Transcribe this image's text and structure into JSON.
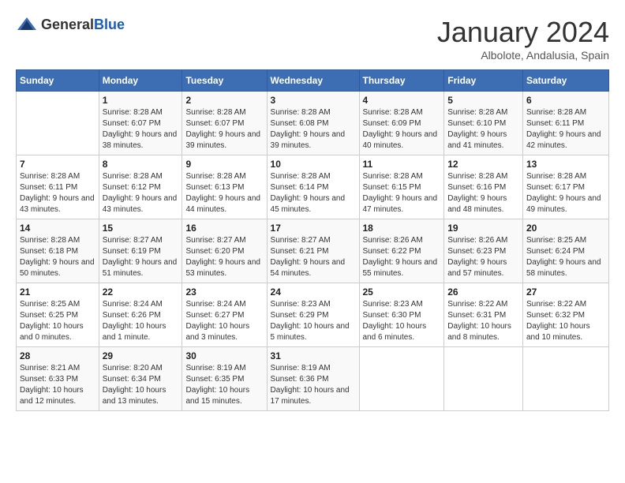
{
  "header": {
    "logo_general": "General",
    "logo_blue": "Blue",
    "title": "January 2024",
    "subtitle": "Albolote, Andalusia, Spain"
  },
  "calendar": {
    "days_of_week": [
      "Sunday",
      "Monday",
      "Tuesday",
      "Wednesday",
      "Thursday",
      "Friday",
      "Saturday"
    ],
    "weeks": [
      [
        {
          "day": "",
          "sunrise": "",
          "sunset": "",
          "daylight": ""
        },
        {
          "day": "1",
          "sunrise": "Sunrise: 8:28 AM",
          "sunset": "Sunset: 6:07 PM",
          "daylight": "Daylight: 9 hours and 38 minutes."
        },
        {
          "day": "2",
          "sunrise": "Sunrise: 8:28 AM",
          "sunset": "Sunset: 6:07 PM",
          "daylight": "Daylight: 9 hours and 39 minutes."
        },
        {
          "day": "3",
          "sunrise": "Sunrise: 8:28 AM",
          "sunset": "Sunset: 6:08 PM",
          "daylight": "Daylight: 9 hours and 39 minutes."
        },
        {
          "day": "4",
          "sunrise": "Sunrise: 8:28 AM",
          "sunset": "Sunset: 6:09 PM",
          "daylight": "Daylight: 9 hours and 40 minutes."
        },
        {
          "day": "5",
          "sunrise": "Sunrise: 8:28 AM",
          "sunset": "Sunset: 6:10 PM",
          "daylight": "Daylight: 9 hours and 41 minutes."
        },
        {
          "day": "6",
          "sunrise": "Sunrise: 8:28 AM",
          "sunset": "Sunset: 6:11 PM",
          "daylight": "Daylight: 9 hours and 42 minutes."
        }
      ],
      [
        {
          "day": "7",
          "sunrise": "Sunrise: 8:28 AM",
          "sunset": "Sunset: 6:11 PM",
          "daylight": "Daylight: 9 hours and 43 minutes."
        },
        {
          "day": "8",
          "sunrise": "Sunrise: 8:28 AM",
          "sunset": "Sunset: 6:12 PM",
          "daylight": "Daylight: 9 hours and 43 minutes."
        },
        {
          "day": "9",
          "sunrise": "Sunrise: 8:28 AM",
          "sunset": "Sunset: 6:13 PM",
          "daylight": "Daylight: 9 hours and 44 minutes."
        },
        {
          "day": "10",
          "sunrise": "Sunrise: 8:28 AM",
          "sunset": "Sunset: 6:14 PM",
          "daylight": "Daylight: 9 hours and 45 minutes."
        },
        {
          "day": "11",
          "sunrise": "Sunrise: 8:28 AM",
          "sunset": "Sunset: 6:15 PM",
          "daylight": "Daylight: 9 hours and 47 minutes."
        },
        {
          "day": "12",
          "sunrise": "Sunrise: 8:28 AM",
          "sunset": "Sunset: 6:16 PM",
          "daylight": "Daylight: 9 hours and 48 minutes."
        },
        {
          "day": "13",
          "sunrise": "Sunrise: 8:28 AM",
          "sunset": "Sunset: 6:17 PM",
          "daylight": "Daylight: 9 hours and 49 minutes."
        }
      ],
      [
        {
          "day": "14",
          "sunrise": "Sunrise: 8:28 AM",
          "sunset": "Sunset: 6:18 PM",
          "daylight": "Daylight: 9 hours and 50 minutes."
        },
        {
          "day": "15",
          "sunrise": "Sunrise: 8:27 AM",
          "sunset": "Sunset: 6:19 PM",
          "daylight": "Daylight: 9 hours and 51 minutes."
        },
        {
          "day": "16",
          "sunrise": "Sunrise: 8:27 AM",
          "sunset": "Sunset: 6:20 PM",
          "daylight": "Daylight: 9 hours and 53 minutes."
        },
        {
          "day": "17",
          "sunrise": "Sunrise: 8:27 AM",
          "sunset": "Sunset: 6:21 PM",
          "daylight": "Daylight: 9 hours and 54 minutes."
        },
        {
          "day": "18",
          "sunrise": "Sunrise: 8:26 AM",
          "sunset": "Sunset: 6:22 PM",
          "daylight": "Daylight: 9 hours and 55 minutes."
        },
        {
          "day": "19",
          "sunrise": "Sunrise: 8:26 AM",
          "sunset": "Sunset: 6:23 PM",
          "daylight": "Daylight: 9 hours and 57 minutes."
        },
        {
          "day": "20",
          "sunrise": "Sunrise: 8:25 AM",
          "sunset": "Sunset: 6:24 PM",
          "daylight": "Daylight: 9 hours and 58 minutes."
        }
      ],
      [
        {
          "day": "21",
          "sunrise": "Sunrise: 8:25 AM",
          "sunset": "Sunset: 6:25 PM",
          "daylight": "Daylight: 10 hours and 0 minutes."
        },
        {
          "day": "22",
          "sunrise": "Sunrise: 8:24 AM",
          "sunset": "Sunset: 6:26 PM",
          "daylight": "Daylight: 10 hours and 1 minute."
        },
        {
          "day": "23",
          "sunrise": "Sunrise: 8:24 AM",
          "sunset": "Sunset: 6:27 PM",
          "daylight": "Daylight: 10 hours and 3 minutes."
        },
        {
          "day": "24",
          "sunrise": "Sunrise: 8:23 AM",
          "sunset": "Sunset: 6:29 PM",
          "daylight": "Daylight: 10 hours and 5 minutes."
        },
        {
          "day": "25",
          "sunrise": "Sunrise: 8:23 AM",
          "sunset": "Sunset: 6:30 PM",
          "daylight": "Daylight: 10 hours and 6 minutes."
        },
        {
          "day": "26",
          "sunrise": "Sunrise: 8:22 AM",
          "sunset": "Sunset: 6:31 PM",
          "daylight": "Daylight: 10 hours and 8 minutes."
        },
        {
          "day": "27",
          "sunrise": "Sunrise: 8:22 AM",
          "sunset": "Sunset: 6:32 PM",
          "daylight": "Daylight: 10 hours and 10 minutes."
        }
      ],
      [
        {
          "day": "28",
          "sunrise": "Sunrise: 8:21 AM",
          "sunset": "Sunset: 6:33 PM",
          "daylight": "Daylight: 10 hours and 12 minutes."
        },
        {
          "day": "29",
          "sunrise": "Sunrise: 8:20 AM",
          "sunset": "Sunset: 6:34 PM",
          "daylight": "Daylight: 10 hours and 13 minutes."
        },
        {
          "day": "30",
          "sunrise": "Sunrise: 8:19 AM",
          "sunset": "Sunset: 6:35 PM",
          "daylight": "Daylight: 10 hours and 15 minutes."
        },
        {
          "day": "31",
          "sunrise": "Sunrise: 8:19 AM",
          "sunset": "Sunset: 6:36 PM",
          "daylight": "Daylight: 10 hours and 17 minutes."
        },
        {
          "day": "",
          "sunrise": "",
          "sunset": "",
          "daylight": ""
        },
        {
          "day": "",
          "sunrise": "",
          "sunset": "",
          "daylight": ""
        },
        {
          "day": "",
          "sunrise": "",
          "sunset": "",
          "daylight": ""
        }
      ]
    ]
  }
}
